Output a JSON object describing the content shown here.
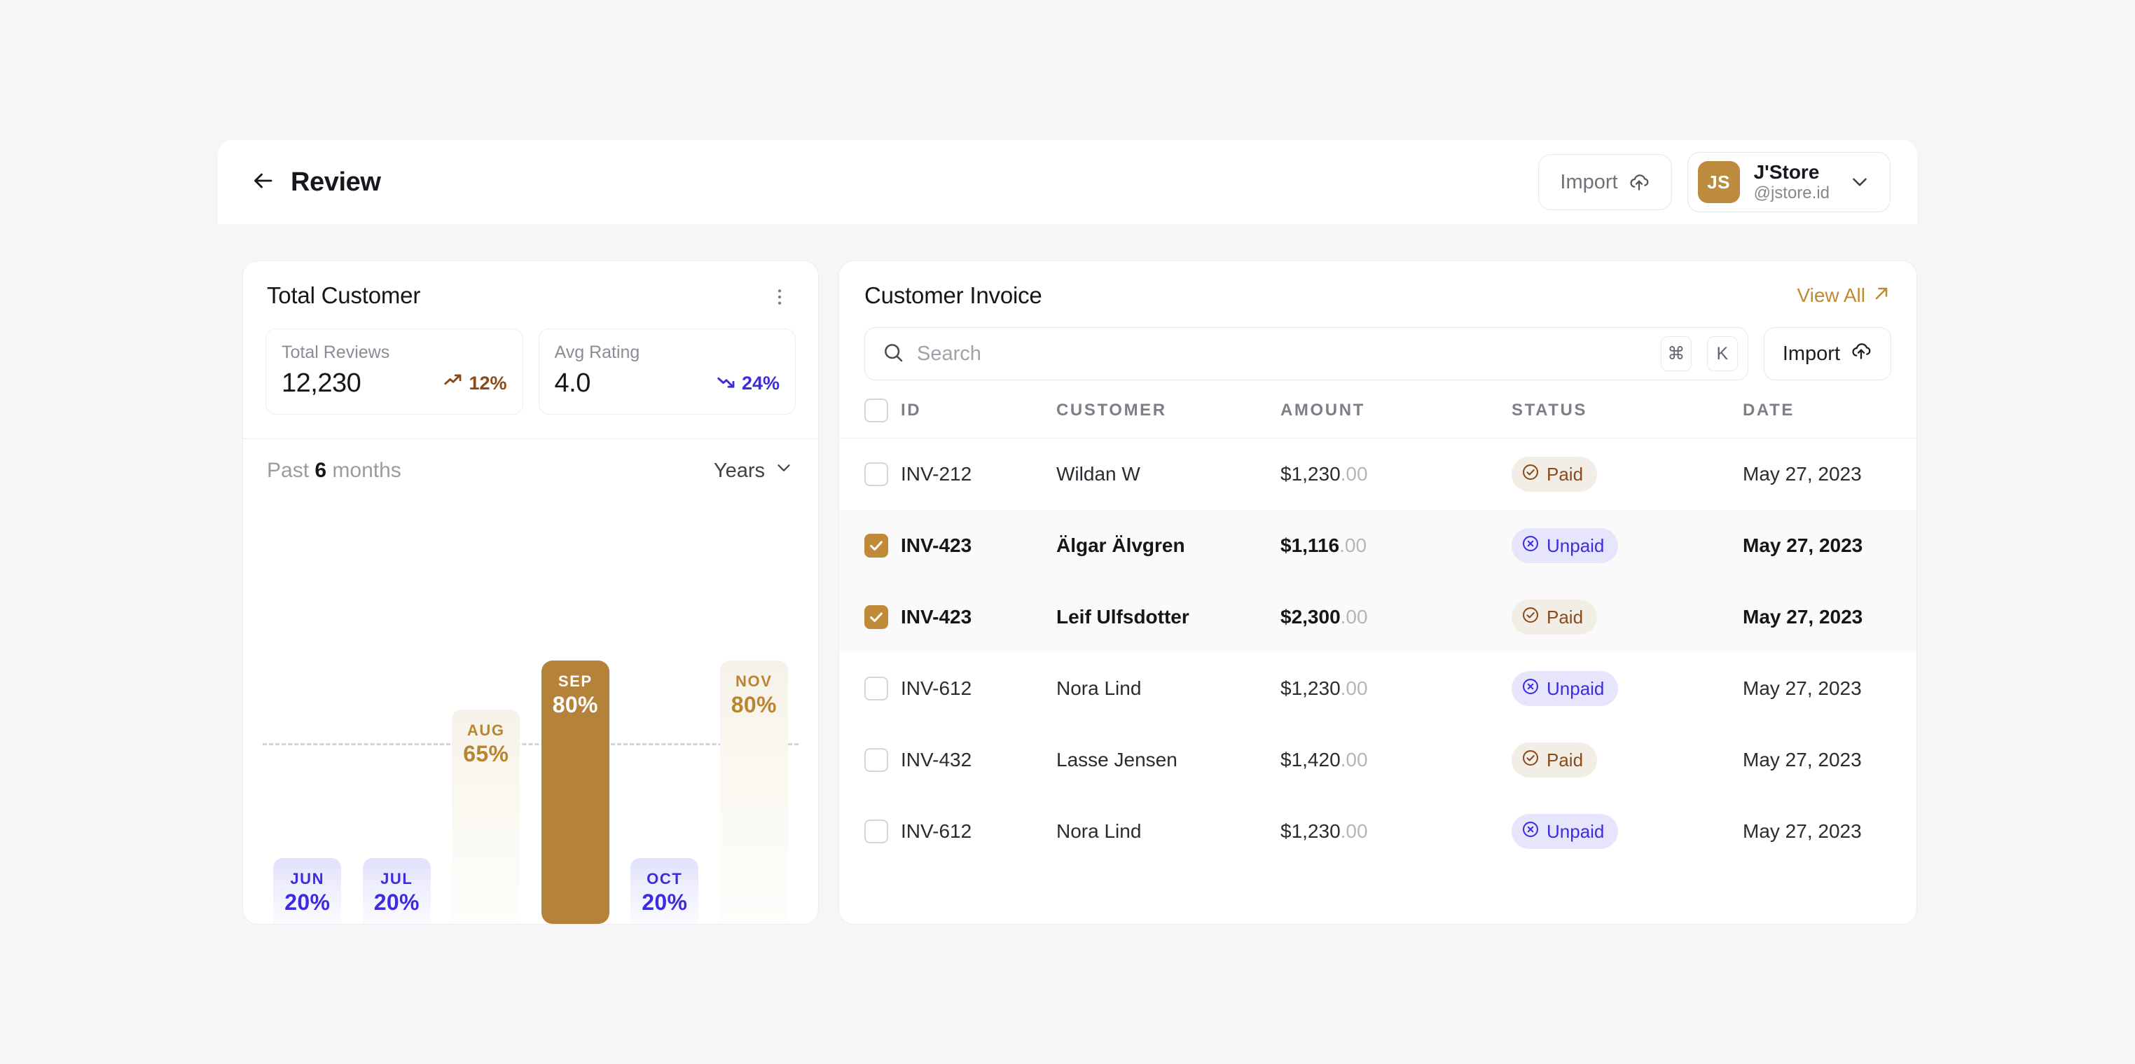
{
  "header": {
    "title": "Review",
    "back_icon": "arrow-left-icon",
    "import_label": "Import",
    "import_icon": "cloud-upload-icon",
    "profile": {
      "initials": "JS",
      "name": "J'Store",
      "handle": "@jstore.id",
      "chevron_icon": "chevron-down-icon"
    }
  },
  "total_customer": {
    "title": "Total Customer",
    "menu_icon": "kebab-menu-icon",
    "stats": [
      {
        "label": "Total Reviews",
        "value": "12,230",
        "delta": "12%",
        "direction": "up",
        "icon": "trending-up-icon"
      },
      {
        "label": "Avg Rating",
        "value": "4.0",
        "delta": "24%",
        "direction": "down",
        "icon": "trending-down-icon"
      }
    ],
    "chart_period_prefix": "Past",
    "chart_period_value": "6",
    "chart_period_suffix": "months",
    "range_selector": "Years",
    "range_chevron_icon": "chevron-down-icon"
  },
  "chart_data": {
    "type": "bar",
    "title": "Past 6 months",
    "categories": [
      "JUN",
      "JUL",
      "AUG",
      "SEP",
      "OCT",
      "NOV"
    ],
    "values": [
      20,
      20,
      65,
      80,
      20,
      80
    ],
    "labels": [
      "20%",
      "20%",
      "65%",
      "80%",
      "20%",
      "80%"
    ],
    "styles": [
      "blue",
      "blue",
      "cream",
      "gold",
      "blue",
      "cream"
    ],
    "highlighted": "SEP",
    "ylabel": "",
    "xlabel": "",
    "ylim": [
      0,
      100
    ],
    "grid": true,
    "gridline_value": 25,
    "legend": "none",
    "colors": {
      "blue_text": "#3d2be0",
      "cream_text": "#b9862f",
      "gold_fill": "#b5823a",
      "gold_text": "#ffffff"
    }
  },
  "invoice": {
    "title": "Customer Invoice",
    "view_all_label": "View All",
    "view_all_icon": "arrow-up-right-icon",
    "search_placeholder": "Search",
    "search_value": "",
    "search_icon": "search-icon",
    "shortcut_keys": [
      "⌘",
      "K"
    ],
    "import_label": "Import",
    "import_icon": "cloud-upload-icon",
    "columns": [
      "ID",
      "CUSTOMER",
      "AMOUNT",
      "STATUS",
      "DATE"
    ],
    "select_all_checked": false,
    "rows": [
      {
        "selected": false,
        "id": "INV-212",
        "customer": "Wildan W",
        "amount": "$1,230",
        "cents": ".00",
        "status": "Paid",
        "date": "May 27, 2023"
      },
      {
        "selected": true,
        "id": "INV-423",
        "customer": "Älgar Älvgren",
        "amount": "$1,116",
        "cents": ".00",
        "status": "Unpaid",
        "date": "May 27, 2023"
      },
      {
        "selected": true,
        "id": "INV-423",
        "customer": "Leif Ulfsdotter",
        "amount": "$2,300",
        "cents": ".00",
        "status": "Paid",
        "date": "May 27, 2023"
      },
      {
        "selected": false,
        "id": "INV-612",
        "customer": "Nora Lind",
        "amount": "$1,230",
        "cents": ".00",
        "status": "Unpaid",
        "date": "May 27, 2023"
      },
      {
        "selected": false,
        "id": "INV-432",
        "customer": "Lasse Jensen",
        "amount": "$1,420",
        "cents": ".00",
        "status": "Paid",
        "date": "May 27, 2023"
      },
      {
        "selected": false,
        "id": "INV-612",
        "customer": "Nora Lind",
        "amount": "$1,230",
        "cents": ".00",
        "status": "Unpaid",
        "date": "May 27, 2023"
      }
    ]
  }
}
